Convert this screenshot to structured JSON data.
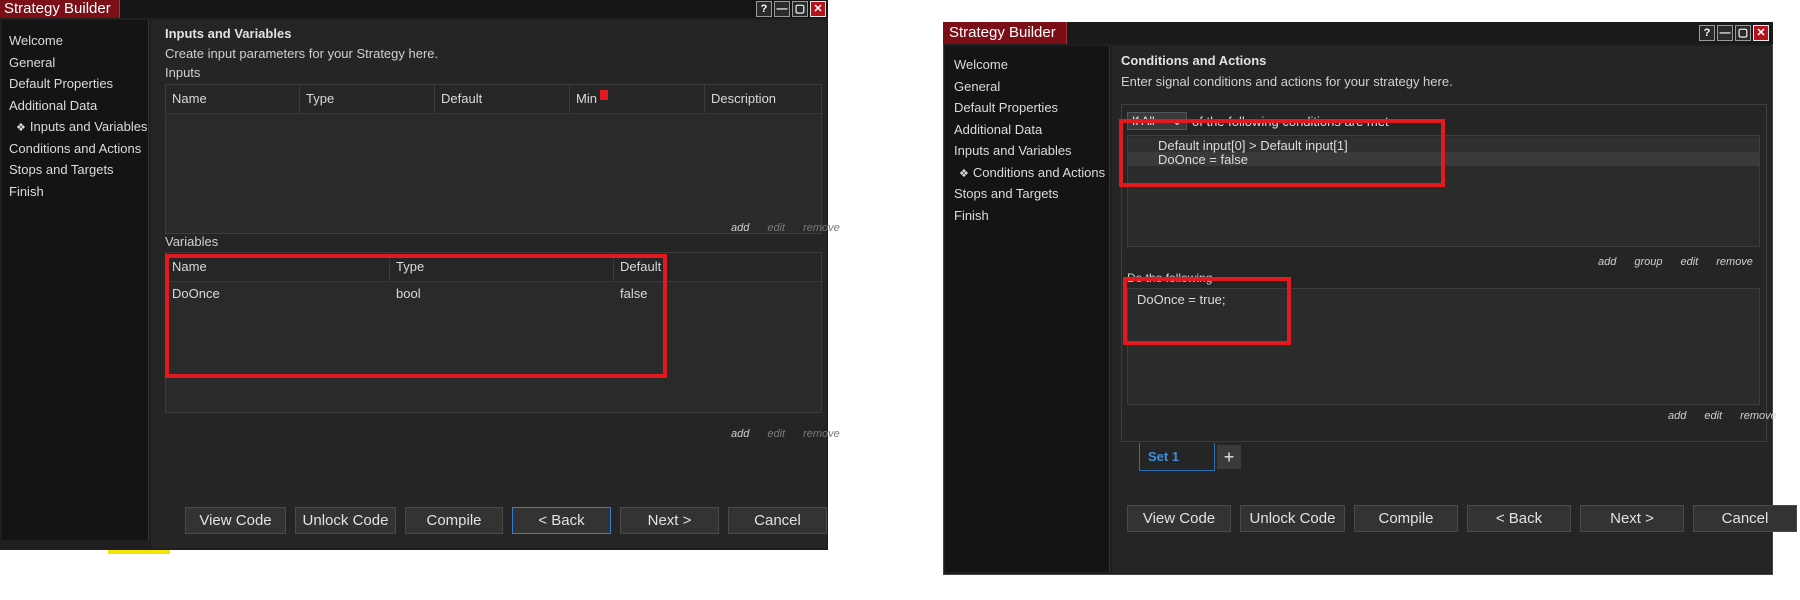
{
  "window_left": {
    "title": "Strategy Builder",
    "titlebar_buttons": [
      "?",
      "—",
      "▢",
      "✕"
    ],
    "nav": [
      {
        "label": "Welcome",
        "active": false
      },
      {
        "label": "General",
        "active": false
      },
      {
        "label": "Default Properties",
        "active": false
      },
      {
        "label": "Additional Data",
        "active": false
      },
      {
        "label": "Inputs and Variables",
        "active": true
      },
      {
        "label": "Conditions and Actions",
        "active": false
      },
      {
        "label": "Stops and Targets",
        "active": false
      },
      {
        "label": "Finish",
        "active": false
      }
    ],
    "page_title": "Inputs and Variables",
    "page_subtitle": "Create input parameters for your Strategy here.",
    "inputs_label": "Inputs",
    "inputs_columns": [
      "Name",
      "Type",
      "Default",
      "Min",
      "Description"
    ],
    "inputs_links": {
      "add": "add",
      "edit": "edit",
      "remove": "remove"
    },
    "variables_label": "Variables",
    "variables_columns": [
      "Name",
      "Type",
      "Default"
    ],
    "variables_rows": [
      {
        "name": "DoOnce",
        "type": "bool",
        "default": "false"
      }
    ],
    "variables_links": {
      "add": "add",
      "edit": "edit",
      "remove": "remove"
    },
    "buttons": {
      "view_code": "View Code",
      "unlock_code": "Unlock Code",
      "compile": "Compile",
      "back": "< Back",
      "next": "Next >",
      "cancel": "Cancel"
    }
  },
  "window_right": {
    "title": "Strategy Builder",
    "titlebar_buttons": [
      "?",
      "—",
      "▢",
      "✕"
    ],
    "nav": [
      {
        "label": "Welcome",
        "active": false
      },
      {
        "label": "General",
        "active": false
      },
      {
        "label": "Default Properties",
        "active": false
      },
      {
        "label": "Additional Data",
        "active": false
      },
      {
        "label": "Inputs and Variables",
        "active": false
      },
      {
        "label": "Conditions and Actions",
        "active": true
      },
      {
        "label": "Stops and Targets",
        "active": false
      },
      {
        "label": "Finish",
        "active": false
      }
    ],
    "page_title": "Conditions and Actions",
    "page_subtitle": "Enter signal conditions and actions for your strategy here.",
    "condition_selector": "If All",
    "condition_text": "of the following conditions are met",
    "conditions": [
      "Default input[0] > Default input[1]",
      "DoOnce = false"
    ],
    "condition_links": {
      "add": "add",
      "group": "group",
      "edit": "edit",
      "remove": "remove"
    },
    "actions_label": "Do the following",
    "actions": [
      "DoOnce = true;"
    ],
    "action_links": {
      "add": "add",
      "edit": "edit",
      "remove": "remove"
    },
    "set_tab": "Set 1",
    "add_set": "+",
    "buttons": {
      "view_code": "View Code",
      "unlock_code": "Unlock Code",
      "compile": "Compile",
      "back": "< Back",
      "next": "Next >",
      "cancel": "Cancel"
    }
  },
  "colors": {
    "title_tab": "#7a0f18",
    "background": "#252526",
    "sidebar": "#141414",
    "annotation_red": "#e4191f",
    "focus_blue": "#2f7fd6"
  }
}
